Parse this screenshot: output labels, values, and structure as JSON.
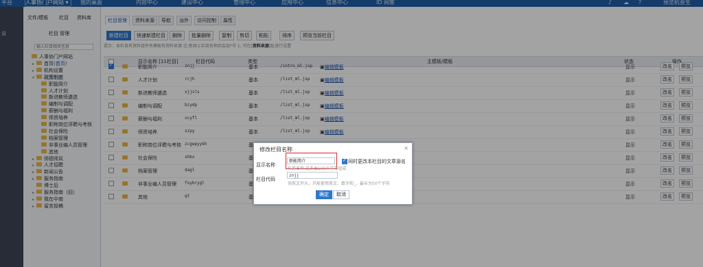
{
  "topbar": {
    "logo_label": "平台",
    "site_selector": "人事协门户网站",
    "menu": [
      "我的桌面",
      "内容中心",
      "建设中心",
      "管理中心",
      "应用中心",
      "信息中心",
      "ID 网客"
    ],
    "user": "预览机会生"
  },
  "leftbar": {
    "label": "设"
  },
  "tree": {
    "tabs": [
      "文件/模板",
      "栏目",
      "资料库"
    ],
    "title": "栏目 管理",
    "search_placeholder": "输入栏目相关信息",
    "nodes": [
      {
        "label": "人事协门户网站",
        "level": 0,
        "expander": "",
        "blue": false
      },
      {
        "label": "首页",
        "suffix": "(首页)",
        "level": 1,
        "expander": "▸",
        "blue": false
      },
      {
        "label": "机构设置",
        "level": 1,
        "expander": "▸",
        "blue": false
      },
      {
        "label": "政策制度",
        "level": 1,
        "expander": "▾",
        "blue": false,
        "selected": true
      },
      {
        "label": "职能简介",
        "level": 2,
        "expander": "",
        "blue": false
      },
      {
        "label": "人才计划",
        "level": 2,
        "expander": "",
        "blue": false
      },
      {
        "label": "新进教师遴选",
        "level": 2,
        "expander": "",
        "blue": false
      },
      {
        "label": "编制与调配",
        "level": 2,
        "expander": "",
        "blue": false
      },
      {
        "label": "薪酬与福利",
        "level": 2,
        "expander": "",
        "blue": false
      },
      {
        "label": "师资培养",
        "level": 2,
        "expander": "",
        "blue": false
      },
      {
        "label": "职称岗位评聘与考核",
        "level": 2,
        "expander": "",
        "blue": false
      },
      {
        "label": "社会保险",
        "level": 2,
        "expander": "",
        "blue": false
      },
      {
        "label": "档案管理",
        "level": 2,
        "expander": "",
        "blue": false
      },
      {
        "label": "非事业编人员管理",
        "level": 2,
        "expander": "",
        "blue": false
      },
      {
        "label": "其他",
        "level": 2,
        "expander": "",
        "blue": false
      },
      {
        "label": "师德师风",
        "level": 1,
        "expander": "▸",
        "blue": false
      },
      {
        "label": "人才招聘",
        "level": 1,
        "expander": "▸",
        "blue": false
      },
      {
        "label": "新闻公告",
        "level": 1,
        "expander": "▸",
        "blue": false
      },
      {
        "label": "服务指南",
        "level": 1,
        "expander": "▸",
        "blue": false
      },
      {
        "label": "博士后",
        "level": 1,
        "expander": "",
        "blue": false
      },
      {
        "label": "服务指南（旧）",
        "level": 1,
        "expander": "▸",
        "blue": false
      },
      {
        "label": "我在中南",
        "level": 1,
        "expander": "▸",
        "blue": false
      },
      {
        "label": "留言投稿",
        "level": 1,
        "expander": "▸",
        "blue": false
      }
    ]
  },
  "main": {
    "tabs": [
      "栏目管理",
      "资料来源",
      "导航",
      "派外",
      "访问控制",
      "属性"
    ],
    "toolbar": [
      "新建栏目",
      "快速新建栏目",
      "删除",
      "批量删除",
      "复制",
      "剪切",
      "粘贴",
      "排序",
      "预览当前栏目"
    ],
    "hint_prefix": "提示：本栏目有资料组件有模板有资料来源 注:新闻上栏目名称后会加",
    "hint_mid": "*号 1, 可在[",
    "hint_bold": "资料来源",
    "hint_suffix": "]处进行设置",
    "columns": [
      "显示名称 [11栏目]",
      "栏目代码",
      "类型",
      "主模板/模板",
      "状态",
      "操作"
    ],
    "rows": [
      {
        "name": "职能简介",
        "code": "znjj",
        "type": "基本",
        "template": "/intro_ml.jsp",
        "edit": "编辑模板",
        "status": "显示",
        "checked": true
      },
      {
        "name": "人才计划",
        "code": "rcjh",
        "type": "基本",
        "template": "/list_ml.jsp",
        "edit": "编辑模板",
        "status": "显示",
        "checked": false
      },
      {
        "name": "新进教师遴选",
        "code": "xjjsls",
        "type": "基本",
        "template": "/list_ml.jsp",
        "edit": "编辑模板",
        "status": "显示",
        "checked": false
      },
      {
        "name": "编制与调配",
        "code": "bzydp",
        "type": "基本",
        "template": "/list_ml.jsp",
        "edit": "编辑模板",
        "status": "显示",
        "checked": false
      },
      {
        "name": "薪酬与福利",
        "code": "xcyfl",
        "type": "基本",
        "template": "/list_ml.jsp",
        "edit": "编辑模板",
        "status": "显示",
        "checked": false
      },
      {
        "name": "师资培养",
        "code": "szpy",
        "type": "基本",
        "template": "/list_ml.jsp",
        "edit": "编辑模板",
        "status": "显示",
        "checked": false
      },
      {
        "name": "职称岗位评聘与考核",
        "code": "zcgwpyykh",
        "type": "基",
        "template": "",
        "edit": "",
        "status": "显示",
        "checked": false
      },
      {
        "name": "社会保险",
        "code": "shbx",
        "type": "基",
        "template": "",
        "edit": "",
        "status": "显示",
        "checked": false
      },
      {
        "name": "档案管理",
        "code": "dagl",
        "type": "基",
        "template": "",
        "edit": "",
        "status": "显示",
        "checked": false
      },
      {
        "name": "非事业编人员管理",
        "code": "fsybrygl",
        "type": "基",
        "template": "",
        "edit": "",
        "status": "显示",
        "checked": false
      },
      {
        "name": "其他",
        "code": "qt",
        "type": "基",
        "template": "",
        "edit": "",
        "status": "显示",
        "checked": false
      }
    ],
    "row_actions": [
      "改名",
      "预览"
    ]
  },
  "dialog": {
    "title": "修改栏目名称",
    "close": "×",
    "display_label": "显示名称",
    "display_value": "职能简介",
    "sync_label": "同时更改本栏目的文章源名",
    "display_note": "栏目名称 最多由100个字符组成",
    "code_label": "栏目代码",
    "code_value": "znjj",
    "code_note": "须英文开头，只能使用英文、数字和_，最长为50个字符",
    "ok": "确定",
    "cancel": "取消"
  }
}
